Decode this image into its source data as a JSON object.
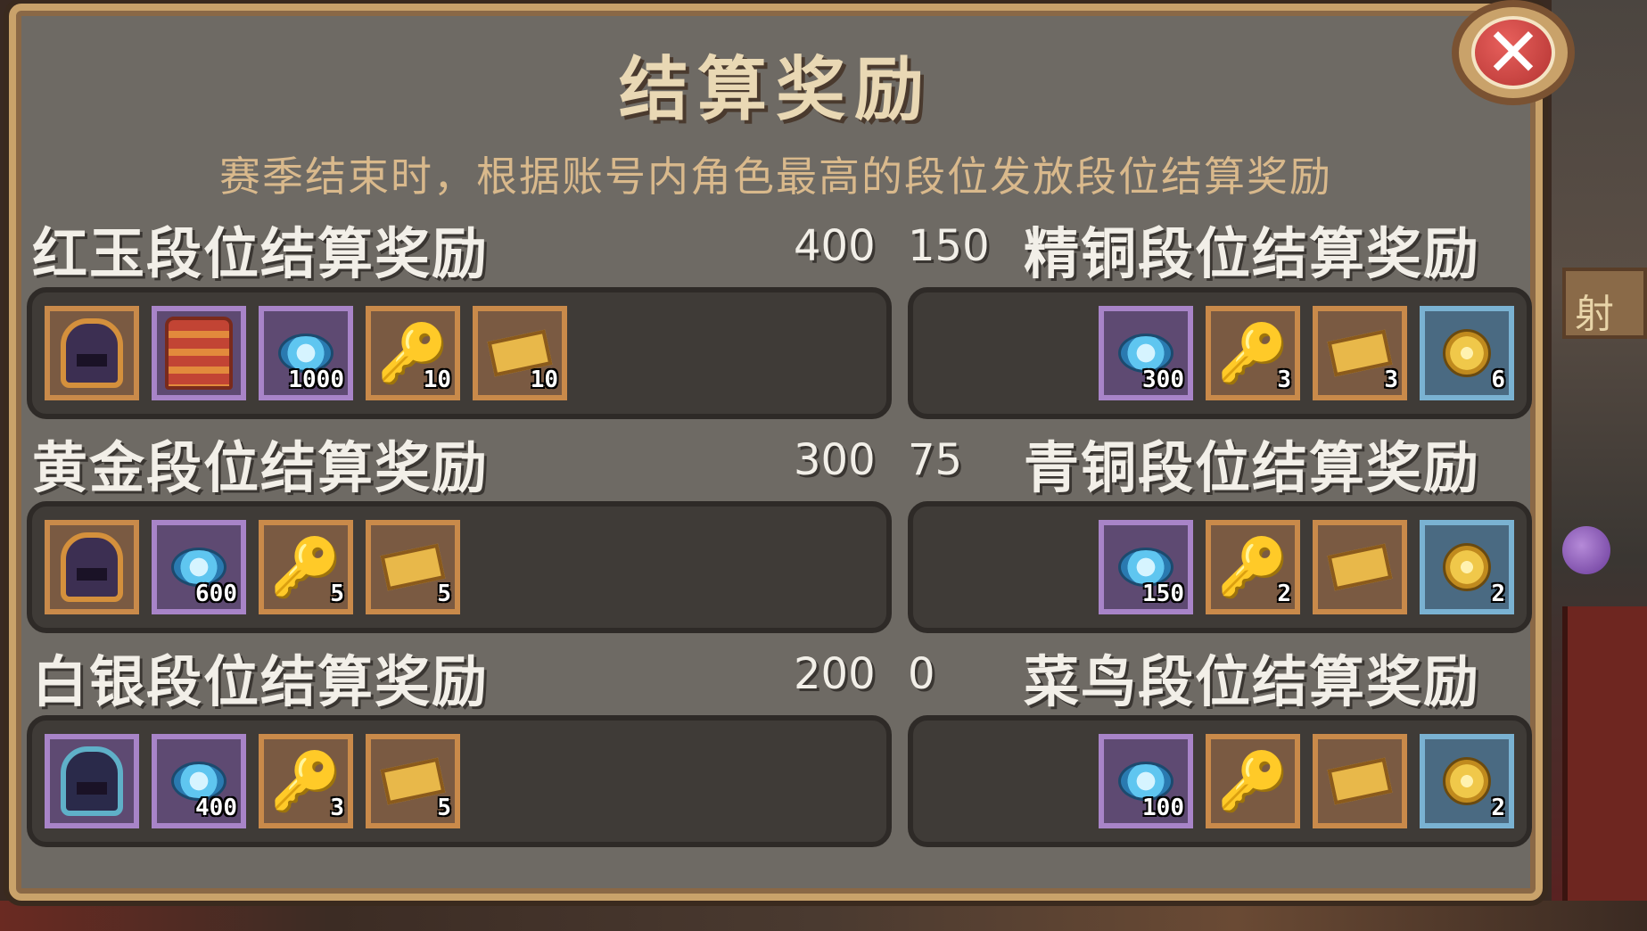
{
  "title": "结算奖励",
  "subtitle": "赛季结束时，根据账号内角色最高的段位发放段位结算奖励",
  "close_label": "✕",
  "background_sign": "射",
  "left_tiers": [
    {
      "name": "红玉段位结算奖励",
      "score": "400",
      "items": [
        {
          "icon": "helmet-icon",
          "frame": "orange",
          "count": ""
        },
        {
          "icon": "armor-icon",
          "frame": "purple",
          "count": ""
        },
        {
          "icon": "gem-icon",
          "frame": "purple",
          "count": "1000"
        },
        {
          "icon": "key-icon",
          "frame": "orange",
          "count": "10"
        },
        {
          "icon": "ticket-icon",
          "frame": "orange",
          "count": "10"
        }
      ]
    },
    {
      "name": "黄金段位结算奖励",
      "score": "300",
      "items": [
        {
          "icon": "helmet-icon",
          "frame": "orange",
          "count": ""
        },
        {
          "icon": "gem-icon",
          "frame": "purple",
          "count": "600"
        },
        {
          "icon": "key-icon",
          "frame": "orange",
          "count": "5"
        },
        {
          "icon": "ticket-icon",
          "frame": "orange",
          "count": "5"
        }
      ]
    },
    {
      "name": "白银段位结算奖励",
      "score": "200",
      "items": [
        {
          "icon": "helmet-silver-icon",
          "frame": "purple",
          "count": ""
        },
        {
          "icon": "gem-icon",
          "frame": "purple",
          "count": "400"
        },
        {
          "icon": "key-icon",
          "frame": "orange",
          "count": "3"
        },
        {
          "icon": "ticket-icon",
          "frame": "orange",
          "count": "5"
        }
      ]
    }
  ],
  "right_tiers": [
    {
      "name": "精铜段位结算奖励",
      "score": "150",
      "items": [
        {
          "icon": "gem-icon",
          "frame": "purple",
          "count": "300"
        },
        {
          "icon": "key-icon",
          "frame": "orange",
          "count": "3"
        },
        {
          "icon": "ticket-icon",
          "frame": "orange",
          "count": "3"
        },
        {
          "icon": "coin-icon",
          "frame": "blue",
          "count": "6"
        }
      ]
    },
    {
      "name": "青铜段位结算奖励",
      "score": "75",
      "items": [
        {
          "icon": "gem-icon",
          "frame": "purple",
          "count": "150"
        },
        {
          "icon": "key-icon",
          "frame": "orange",
          "count": "2"
        },
        {
          "icon": "ticket-icon",
          "frame": "orange",
          "count": ""
        },
        {
          "icon": "coin-icon",
          "frame": "blue",
          "count": "2"
        }
      ]
    },
    {
      "name": "菜鸟段位结算奖励",
      "score": "0",
      "items": [
        {
          "icon": "gem-icon",
          "frame": "purple",
          "count": "100"
        },
        {
          "icon": "key-icon",
          "frame": "orange",
          "count": ""
        },
        {
          "icon": "ticket-icon",
          "frame": "orange",
          "count": ""
        },
        {
          "icon": "coin-icon",
          "frame": "blue",
          "count": "2"
        }
      ]
    }
  ],
  "colors": {
    "panel": "#6e6a64",
    "border_gold": "#c9a26a",
    "title_text": "#e9d8b4",
    "subtitle_text": "#d9b98c",
    "frame_orange": "#c98a4a",
    "frame_purple": "#a884c8",
    "frame_blue": "#7ab2d2"
  }
}
